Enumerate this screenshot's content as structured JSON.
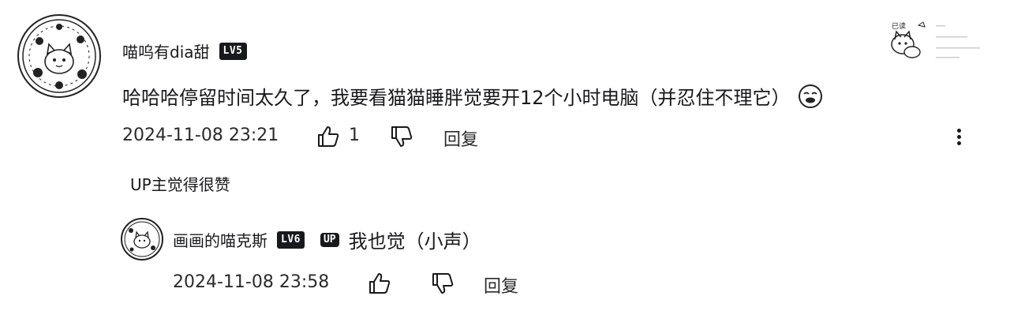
{
  "comment": {
    "username": "喵呜有dia甜",
    "level_badge": "LV5",
    "content": "哈哈哈停留时间太久了，我要看猫猫睡胖觉要开12个小时电脑（并忍住不理它）",
    "timestamp": "2024-11-08 23:21",
    "like_count": "1",
    "reply_label": "回复",
    "up_liked_label": "UP主觉得很赞",
    "icons": {
      "avatar": "cartoon-cat-avatar",
      "like": "thumbs-up-icon",
      "dislike": "thumbs-down-icon",
      "more": "more-vertical-icon",
      "emoji": "emoji-icon",
      "decoration": "cat-sticker-decoration"
    }
  },
  "reply": {
    "username": "画画的喵克斯",
    "level_badge": "LV6",
    "up_badge": "UP",
    "content": "我也觉（小声）",
    "timestamp": "2024-11-08 23:58",
    "reply_label": "回复"
  },
  "colors": {
    "text": "#18191c",
    "background": "#ffffff"
  }
}
